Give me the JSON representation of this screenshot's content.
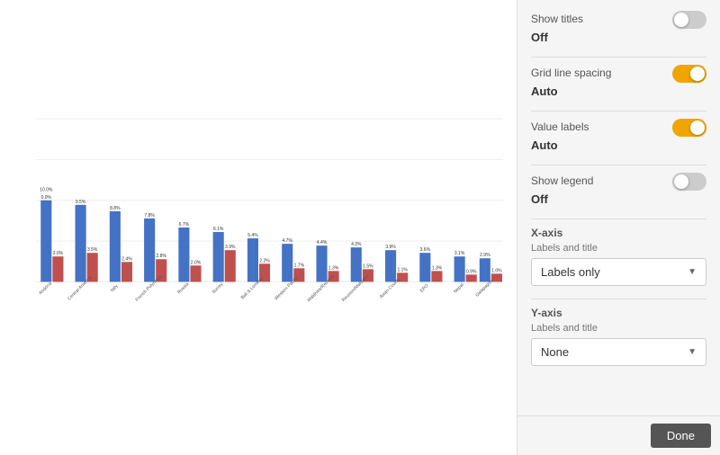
{
  "settings": {
    "show_titles": {
      "label": "Show titles",
      "value": "Off",
      "state": "off"
    },
    "grid_line_spacing": {
      "label": "Grid line spacing",
      "value": "Auto",
      "state": "on"
    },
    "value_labels": {
      "label": "Value labels",
      "value": "Auto",
      "state": "on"
    },
    "show_legend": {
      "label": "Show legend",
      "value": "Off",
      "state": "off"
    },
    "x_axis": {
      "section_label": "X-axis",
      "sub_label": "Labels and title",
      "selected": "Labels only"
    },
    "y_axis": {
      "section_label": "Y-axis",
      "sub_label": "Labels and title",
      "selected": "None"
    }
  },
  "buttons": {
    "done": "Done"
  },
  "chart": {
    "bars": [
      {
        "label": "Andorra",
        "blue": 90,
        "red": 28
      },
      {
        "label": "Central America",
        "blue": 85,
        "red": 32
      },
      {
        "label": "Italy",
        "blue": 78,
        "red": 22
      },
      {
        "label": "French Polynesia",
        "blue": 70,
        "red": 25
      },
      {
        "label": "Russia",
        "blue": 60,
        "red": 18
      },
      {
        "label": "Surrey",
        "blue": 55,
        "red": 35
      },
      {
        "label": "Bali & Lombok",
        "blue": 48,
        "red": 20
      },
      {
        "label": "Western Pacific",
        "blue": 42,
        "red": 15
      },
      {
        "label": "Maldives/Reunion",
        "blue": 40,
        "red": 12
      },
      {
        "label": "Reunion/Maldives",
        "blue": 38,
        "red": 14
      },
      {
        "label": "Asian County",
        "blue": 35,
        "red": 10
      },
      {
        "label": "EPO",
        "blue": 30,
        "red": 12
      },
      {
        "label": "Nepal",
        "blue": 28,
        "red": 8
      },
      {
        "label": "Galapagos",
        "blue": 26,
        "red": 9
      }
    ]
  }
}
